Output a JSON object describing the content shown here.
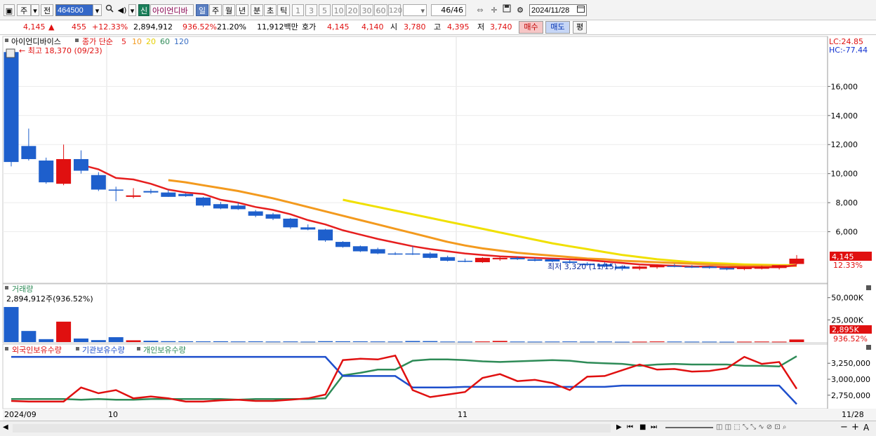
{
  "toolbar": {
    "market": "주",
    "prev_label": "전",
    "stock_code": "464500",
    "badge": "신",
    "stock_name": "아이언디바",
    "periods": [
      "일",
      "주",
      "월",
      "년",
      "분",
      "초",
      "틱"
    ],
    "selected_period": "일",
    "intervals": [
      "1",
      "3",
      "5",
      "10",
      "20",
      "30",
      "60",
      "120"
    ],
    "page_info": "46/46",
    "date": "2024/11/28"
  },
  "quote": {
    "price": "4,145",
    "change": "455",
    "change_pct": "+12.33%",
    "volume": "2,894,912",
    "volume_ratio": "936.52%",
    "turnover": "21.20%",
    "amount": "11,912백만",
    "bid_label": "호가",
    "ask_price": "4,145",
    "bid_price": "4,140",
    "open_label": "시",
    "open": "3,780",
    "high_label": "고",
    "high": "4,395",
    "low_label": "저",
    "low": "3,740",
    "buy_label": "매수",
    "sell_label": "매도",
    "avg_label": "평"
  },
  "chart_data": {
    "type": "candlestick",
    "legend": {
      "name": "아이언디바이스",
      "ma_label": "종가 단순",
      "ma_periods": [
        {
          "label": "5",
          "color": "#e61e1e"
        },
        {
          "label": "10",
          "color": "#f39a1e"
        },
        {
          "label": "20",
          "color": "#f0e000"
        },
        {
          "label": "60",
          "color": "#2e8b57"
        },
        {
          "label": "120",
          "color": "#3a6fc4"
        }
      ]
    },
    "annotations": {
      "high": "최고 18,370 (09/23)",
      "low": "최저 3,320 (11/15)"
    },
    "y_axis": {
      "ticks": [
        "6,000",
        "8,000",
        "10,000",
        "12,000",
        "14,000",
        "16,000"
      ],
      "range": [
        3000,
        18500
      ],
      "lc": "LC:24.85",
      "hc": "HC:-77.44",
      "current_price": "4,145",
      "current_change": "12.33%"
    },
    "x_axis": {
      "labels": [
        "2024/09",
        "10",
        "11",
        "11/28"
      ]
    },
    "colors": {
      "up": "#e01010",
      "down": "#1e5fcc"
    },
    "candles": [
      {
        "o": 18370,
        "h": 18370,
        "l": 10500,
        "c": 10800
      },
      {
        "o": 11900,
        "h": 13100,
        "l": 10900,
        "c": 11000
      },
      {
        "o": 10900,
        "h": 11100,
        "l": 9300,
        "c": 9400
      },
      {
        "o": 9300,
        "h": 12000,
        "l": 9200,
        "c": 11000
      },
      {
        "o": 11000,
        "h": 11600,
        "l": 10000,
        "c": 10200
      },
      {
        "o": 9900,
        "h": 10100,
        "l": 8800,
        "c": 8900
      },
      {
        "o": 8900,
        "h": 9100,
        "l": 8100,
        "c": 8850
      },
      {
        "o": 8400,
        "h": 9000,
        "l": 8300,
        "c": 8500
      },
      {
        "o": 8800,
        "h": 8950,
        "l": 8600,
        "c": 8700
      },
      {
        "o": 8700,
        "h": 8900,
        "l": 8400,
        "c": 8400
      },
      {
        "o": 8600,
        "h": 8650,
        "l": 8400,
        "c": 8450
      },
      {
        "o": 8350,
        "h": 8400,
        "l": 7700,
        "c": 7800
      },
      {
        "o": 7900,
        "h": 8050,
        "l": 7550,
        "c": 7600
      },
      {
        "o": 7800,
        "h": 8000,
        "l": 7500,
        "c": 7550
      },
      {
        "o": 7400,
        "h": 7500,
        "l": 7000,
        "c": 7100
      },
      {
        "o": 7200,
        "h": 7300,
        "l": 6800,
        "c": 6900
      },
      {
        "o": 6900,
        "h": 6950,
        "l": 6200,
        "c": 6300
      },
      {
        "o": 6300,
        "h": 6500,
        "l": 6100,
        "c": 6150
      },
      {
        "o": 6150,
        "h": 6200,
        "l": 5300,
        "c": 5400
      },
      {
        "o": 5300,
        "h": 5350,
        "l": 4900,
        "c": 4950
      },
      {
        "o": 5000,
        "h": 5050,
        "l": 4600,
        "c": 4650
      },
      {
        "o": 4800,
        "h": 4900,
        "l": 4450,
        "c": 4500
      },
      {
        "o": 4500,
        "h": 4600,
        "l": 4400,
        "c": 4450
      },
      {
        "o": 4500,
        "h": 5000,
        "l": 4400,
        "c": 4450
      },
      {
        "o": 4500,
        "h": 4600,
        "l": 4150,
        "c": 4200
      },
      {
        "o": 4250,
        "h": 4350,
        "l": 3950,
        "c": 4000
      },
      {
        "o": 4000,
        "h": 4150,
        "l": 3900,
        "c": 3950
      },
      {
        "o": 3900,
        "h": 4250,
        "l": 3850,
        "c": 4200
      },
      {
        "o": 4100,
        "h": 4250,
        "l": 4000,
        "c": 4200
      },
      {
        "o": 4200,
        "h": 4300,
        "l": 4050,
        "c": 4100
      },
      {
        "o": 4100,
        "h": 4200,
        "l": 3950,
        "c": 4000
      },
      {
        "o": 4100,
        "h": 4150,
        "l": 3900,
        "c": 3950
      },
      {
        "o": 3950,
        "h": 4050,
        "l": 3800,
        "c": 3850
      },
      {
        "o": 3800,
        "h": 3900,
        "l": 3650,
        "c": 3700
      },
      {
        "o": 3750,
        "h": 3900,
        "l": 3550,
        "c": 3600
      },
      {
        "o": 3600,
        "h": 3700,
        "l": 3320,
        "c": 3450
      },
      {
        "o": 3450,
        "h": 3650,
        "l": 3350,
        "c": 3600
      },
      {
        "o": 3550,
        "h": 3750,
        "l": 3450,
        "c": 3700
      },
      {
        "o": 3650,
        "h": 3800,
        "l": 3550,
        "c": 3600
      },
      {
        "o": 3600,
        "h": 3700,
        "l": 3500,
        "c": 3550
      },
      {
        "o": 3600,
        "h": 3650,
        "l": 3450,
        "c": 3500
      },
      {
        "o": 3500,
        "h": 3550,
        "l": 3350,
        "c": 3400
      },
      {
        "o": 3450,
        "h": 3600,
        "l": 3350,
        "c": 3500
      },
      {
        "o": 3450,
        "h": 3650,
        "l": 3400,
        "c": 3550
      },
      {
        "o": 3500,
        "h": 3700,
        "l": 3400,
        "c": 3690
      },
      {
        "o": 3780,
        "h": 4395,
        "l": 3740,
        "c": 4145
      }
    ],
    "ma5": [
      null,
      null,
      null,
      null,
      10600,
      10300,
      9700,
      9600,
      9300,
      8900,
      8700,
      8600,
      8200,
      8000,
      7700,
      7500,
      7200,
      6800,
      6500,
      6100,
      5800,
      5500,
      5250,
      5000,
      4800,
      4650,
      4500,
      4400,
      4300,
      4250,
      4200,
      4150,
      4100,
      4050,
      3950,
      3850,
      3750,
      3700,
      3650,
      3600,
      3600,
      3550,
      3550,
      3550,
      3550,
      3700
    ],
    "ma10": [
      null,
      null,
      null,
      null,
      null,
      null,
      null,
      null,
      null,
      9550,
      9400,
      9200,
      9000,
      8800,
      8550,
      8300,
      8000,
      7700,
      7400,
      7100,
      6800,
      6500,
      6200,
      5900,
      5600,
      5300,
      5050,
      4850,
      4700,
      4550,
      4450,
      4350,
      4250,
      4150,
      4100,
      4000,
      3950,
      3900,
      3850,
      3800,
      3750,
      3700,
      3650,
      3650,
      3650,
      3650
    ],
    "ma20": [
      null,
      null,
      null,
      null,
      null,
      null,
      null,
      null,
      null,
      null,
      null,
      null,
      null,
      null,
      null,
      null,
      null,
      null,
      null,
      8200,
      7950,
      7700,
      7450,
      7200,
      6950,
      6700,
      6450,
      6200,
      5950,
      5700,
      5450,
      5200,
      5000,
      4800,
      4600,
      4400,
      4250,
      4100,
      4000,
      3900,
      3850,
      3800,
      3750,
      3720,
      3700,
      3700
    ],
    "volume": {
      "label": "거래량",
      "info": "2,894,912주(936.52%)",
      "ticks": [
        "50,000K",
        "25,000K"
      ],
      "max": 60000,
      "current": "2,895K",
      "current_pct": "936.52%",
      "values": [
        39500,
        12500,
        3300,
        23000,
        4000,
        2200,
        5500,
        2000,
        1500,
        1000,
        900,
        800,
        900,
        700,
        800,
        600,
        700,
        500,
        1000,
        900,
        800,
        700,
        600,
        1200,
        1100,
        600,
        500,
        700,
        1300,
        600,
        500,
        600,
        700,
        500,
        600,
        400,
        500,
        700,
        600,
        500,
        500,
        400,
        500,
        600,
        500,
        2895
      ]
    },
    "holdings": {
      "labels": [
        "외국인보유수량",
        "기관보유수량",
        "개인보유수량"
      ],
      "colors": [
        "#e01010",
        "#1e4fcc",
        "#2e8b57"
      ],
      "ticks": [
        "3,250,000",
        "3,000,000",
        "2,750,000"
      ],
      "range": [
        2550000,
        3450000
      ],
      "foreign": [
        2660000,
        2650000,
        2650000,
        2650000,
        2870000,
        2780000,
        2830000,
        2700000,
        2730000,
        2700000,
        2650000,
        2650000,
        2670000,
        2680000,
        2660000,
        2660000,
        2680000,
        2700000,
        2760000,
        3300000,
        3320000,
        3310000,
        3370000,
        2830000,
        2720000,
        2760000,
        2800000,
        3020000,
        3080000,
        2970000,
        2990000,
        2940000,
        2830000,
        3040000,
        3050000,
        3140000,
        3230000,
        3150000,
        3160000,
        3120000,
        3130000,
        3170000,
        3350000,
        3240000,
        3270000,
        2850000
      ],
      "institution": [
        3350000,
        3350000,
        3350000,
        3350000,
        3350000,
        3350000,
        3350000,
        3350000,
        3350000,
        3350000,
        3350000,
        3350000,
        3350000,
        3350000,
        3350000,
        3350000,
        3350000,
        3350000,
        3350000,
        3050000,
        3050000,
        3050000,
        3050000,
        2870000,
        2870000,
        2870000,
        2880000,
        2880000,
        2880000,
        2880000,
        2880000,
        2880000,
        2880000,
        2880000,
        2880000,
        2900000,
        2900000,
        2900000,
        2900000,
        2900000,
        2900000,
        2900000,
        2900000,
        2900000,
        2900000,
        2610000
      ],
      "individual": [
        2690000,
        2690000,
        2690000,
        2690000,
        2680000,
        2690000,
        2680000,
        2680000,
        2690000,
        2690000,
        2690000,
        2690000,
        2690000,
        2680000,
        2690000,
        2690000,
        2690000,
        2690000,
        2700000,
        3060000,
        3100000,
        3150000,
        3150000,
        3290000,
        3310000,
        3310000,
        3300000,
        3280000,
        3270000,
        3280000,
        3290000,
        3300000,
        3290000,
        3260000,
        3250000,
        3240000,
        3210000,
        3230000,
        3240000,
        3230000,
        3230000,
        3230000,
        3210000,
        3210000,
        3200000,
        3360000
      ]
    }
  },
  "footer": {
    "icons": [
      "play-icon",
      "first-icon",
      "stop-icon",
      "last-icon",
      "zoom-minus-icon",
      "zoom-plus-icon"
    ]
  }
}
